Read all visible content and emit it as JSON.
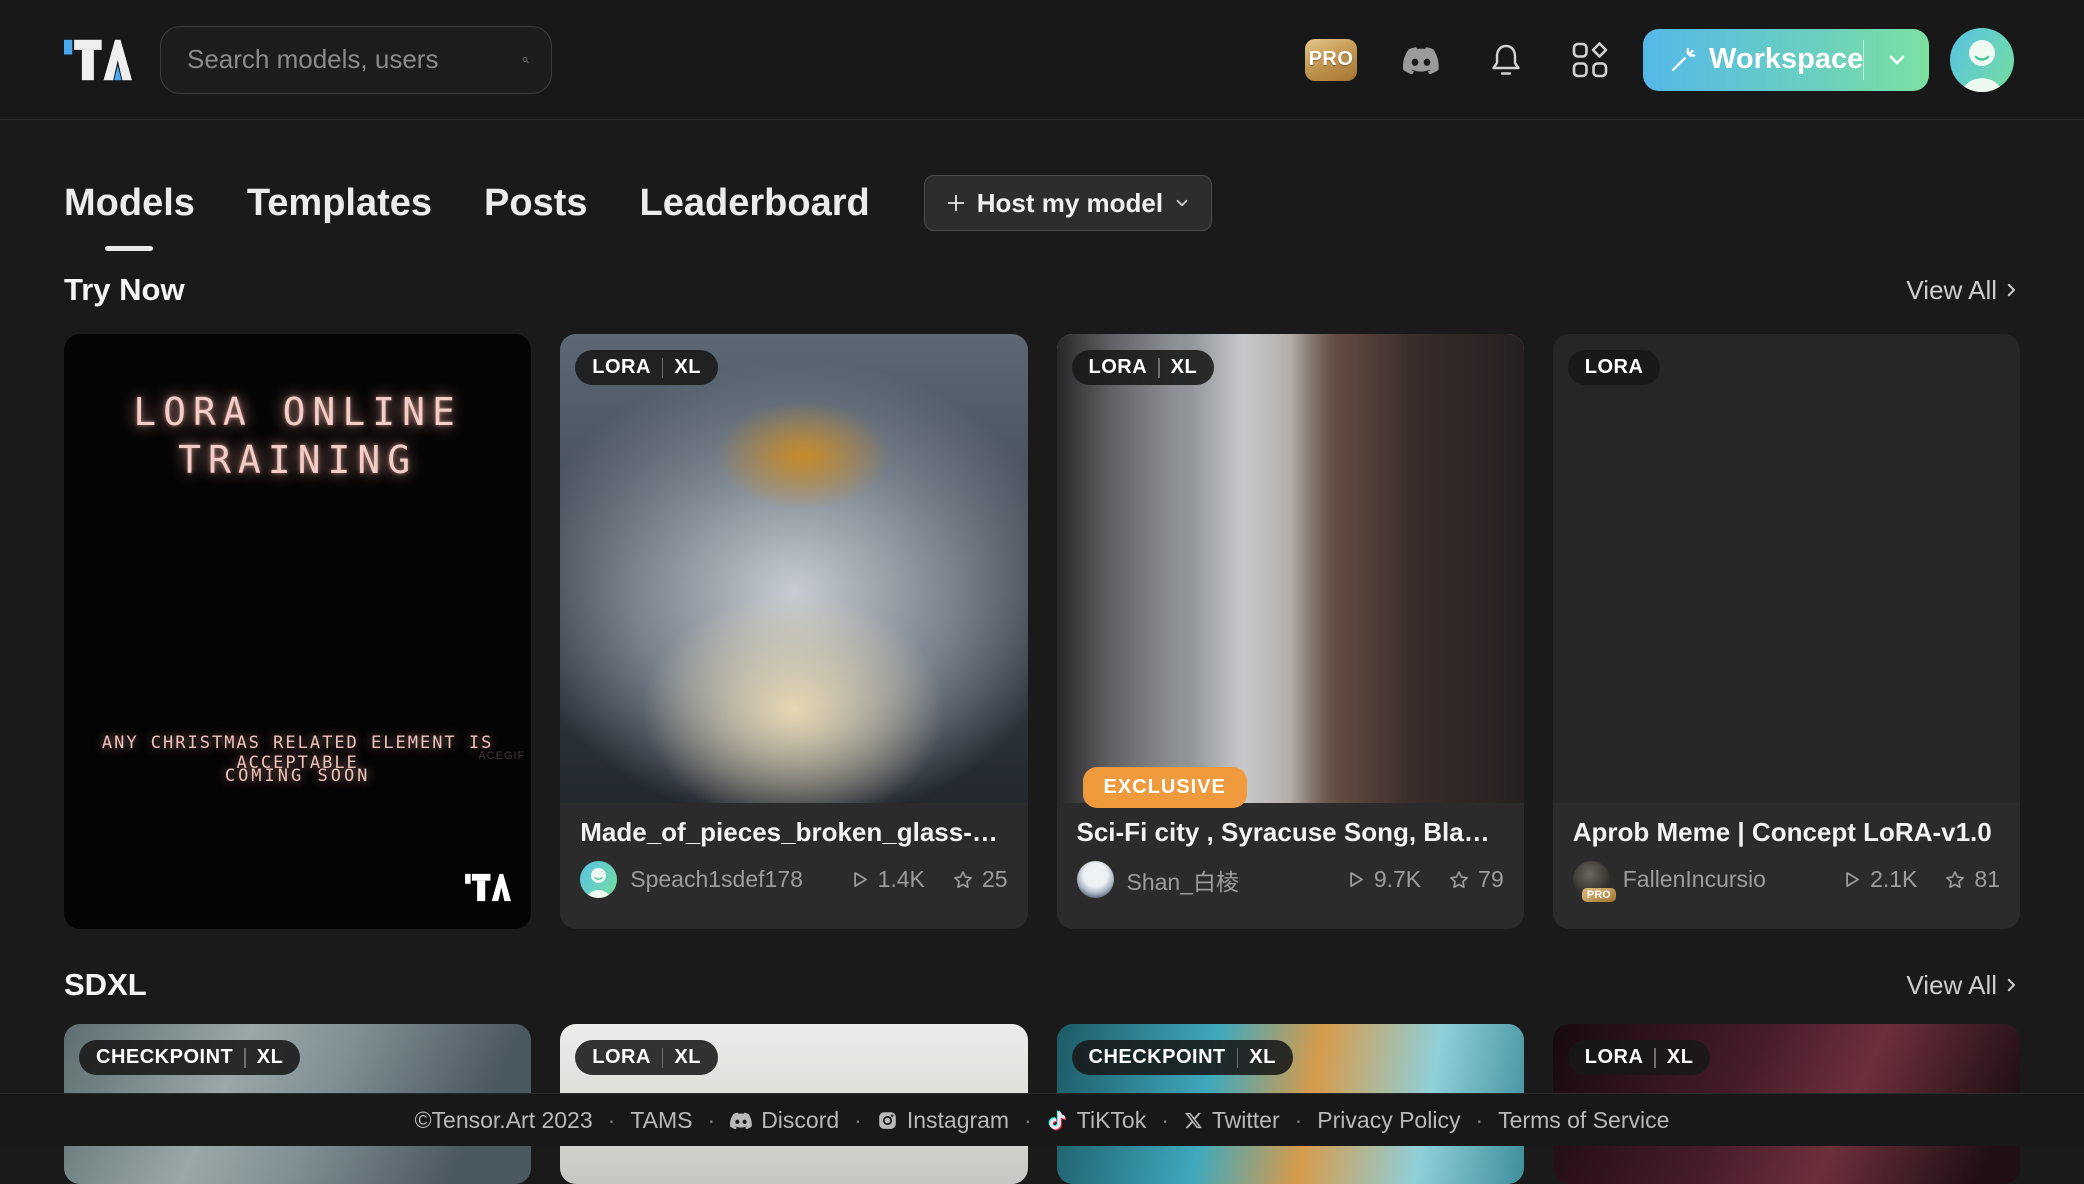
{
  "header": {
    "logo": "TA",
    "search": {
      "placeholder": "Search models, users"
    },
    "pro_badge": "PRO",
    "workspace": {
      "label": "Workspace"
    }
  },
  "nav": {
    "tabs": [
      {
        "label": "Models",
        "active": true
      },
      {
        "label": "Templates",
        "active": false
      },
      {
        "label": "Posts",
        "active": false
      },
      {
        "label": "Leaderboard",
        "active": false
      }
    ],
    "host_button_label": "Host my model"
  },
  "sections": {
    "try_now": {
      "title": "Try Now",
      "view_all": "View All"
    },
    "sdxl": {
      "title": "SDXL",
      "view_all": "View All"
    }
  },
  "promo_card": {
    "headline_line1": "LORA ONLINE",
    "headline_line2": "TRAINING",
    "subline1": "ANY CHRISTMAS RELATED ELEMENT IS ACCEPTABLE",
    "subline2": "COMING SOON",
    "watermark": "ACEGIF",
    "logo": "TA"
  },
  "cards": [
    {
      "badges": [
        "LORA",
        "XL"
      ],
      "title": "Made_of_pieces_broken_glass-Pie...",
      "author": "Speach1sdef178",
      "runs": "1.4K",
      "stars": "25"
    },
    {
      "badges": [
        "LORA",
        "XL"
      ],
      "exclusive_label": "EXCLUSIVE",
      "title": "Sci-Fi city , Syracuse Song, Black a...",
      "author": "Shan_白棱",
      "runs": "9.7K",
      "stars": "79"
    },
    {
      "badges": [
        "LORA"
      ],
      "title": "Aprob Meme | Concept LoRA-v1.0",
      "author": "FallenIncursio",
      "author_badge": "PRO",
      "runs": "2.1K",
      "stars": "81"
    }
  ],
  "sdxl_cards": [
    {
      "badges": [
        "CHECKPOINT",
        "XL"
      ]
    },
    {
      "badges": [
        "LORA",
        "XL"
      ]
    },
    {
      "badges": [
        "CHECKPOINT",
        "XL"
      ]
    },
    {
      "badges": [
        "LORA",
        "XL"
      ]
    }
  ],
  "footer": {
    "separator": "·",
    "items": [
      {
        "label": "©Tensor.Art 2023"
      },
      {
        "label": "TAMS"
      },
      {
        "label": "Discord",
        "icon": "discord"
      },
      {
        "label": "Instagram",
        "icon": "instagram"
      },
      {
        "label": "TiKTok",
        "icon": "tiktok"
      },
      {
        "label": "Twitter",
        "icon": "x-twitter"
      },
      {
        "label": "Privacy Policy"
      },
      {
        "label": "Terms of Service"
      }
    ]
  },
  "icons": {
    "search": "magnifier",
    "discord": "discord-logo",
    "notifications": "bell",
    "apps": "grid-of-shapes",
    "workspace": "magic-wand",
    "workspace_more": "chevron-down",
    "host_model": "plus + chevron-down",
    "view_all": "chevron-right",
    "runs": "play-triangle-outline",
    "stars": "star-outline"
  },
  "colors": {
    "page_bg": "#1A1A1A",
    "header_bg": "#181818",
    "card_footer_bg": "#2B2B2B",
    "workspace_gradient_start": "#54B9E8",
    "workspace_gradient_end": "#7CE0A2",
    "exclusive_badge": "#F09A3E",
    "pro_gold": "#C9A163",
    "logo_accent_blue": "#4AA8EF",
    "promo_text_pink": "#F3CDC8"
  }
}
